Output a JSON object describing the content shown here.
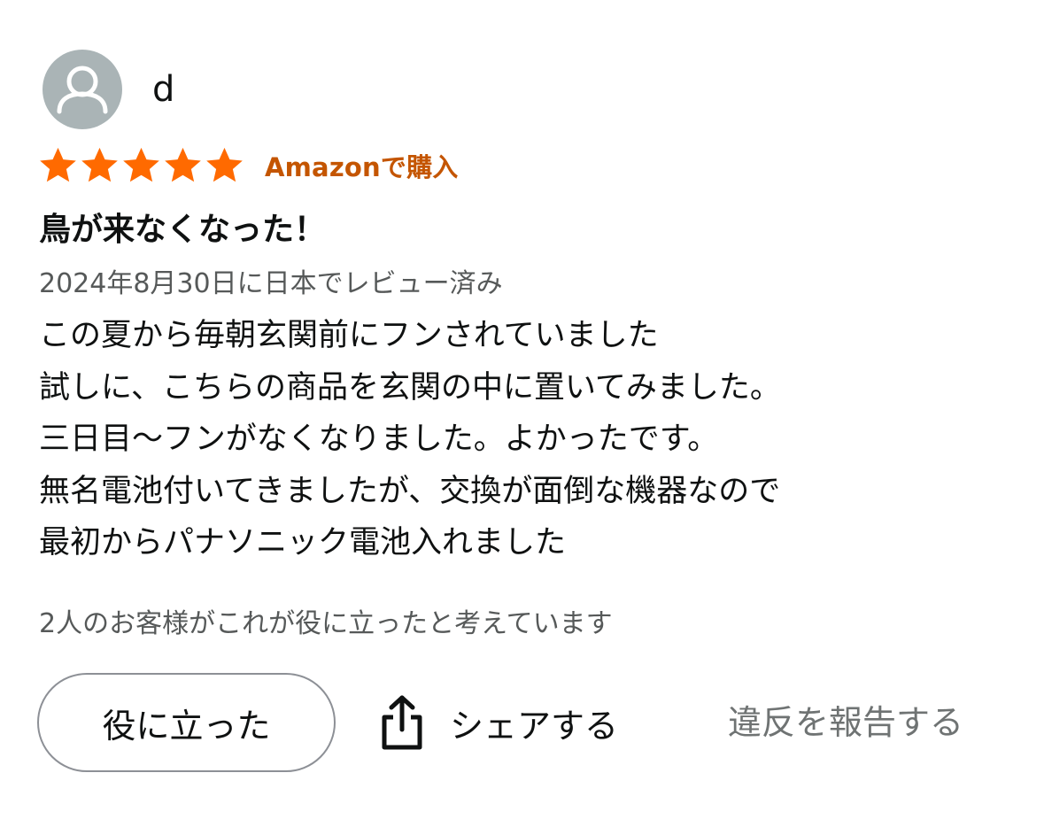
{
  "reviewer": {
    "name": "d",
    "avatar_icon": "person-silhouette-icon",
    "avatar_color": "#aab4b6"
  },
  "rating": {
    "stars": 5,
    "max_stars": 5,
    "star_color": "#ff6a00",
    "badge": "Amazonで購入",
    "badge_color": "#c45500"
  },
  "review": {
    "title": "鳥が来なくなった！",
    "date": "2024年8月30日に日本でレビュー済み",
    "body_lines": [
      "この夏から毎朝玄関前にフンされていました",
      "試しに、こちらの商品を玄関の中に置いてみました。",
      "三日目〜フンがなくなりました。よかったです。",
      "無名電池付いてきましたが、交換が面倒な機器なので",
      "最初からパナソニック電池入れました"
    ],
    "helpful_count_text": "2人のお客様がこれが役に立ったと考えています"
  },
  "actions": {
    "helpful_label": "役に立った",
    "share_label": "シェアする",
    "share_icon": "share-icon",
    "report_label": "違反を報告する"
  }
}
